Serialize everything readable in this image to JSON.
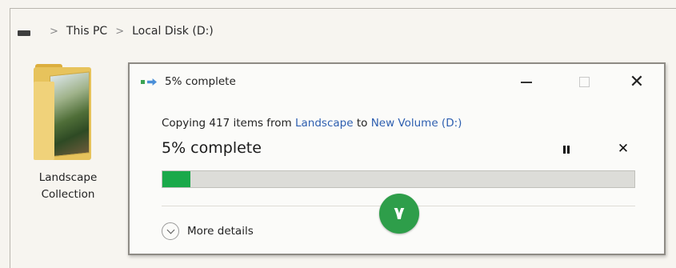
{
  "breadcrumb": {
    "drive_icon": "drive-icon",
    "items": [
      "This PC",
      "Local Disk (D:)"
    ],
    "separator": ">"
  },
  "desktop": {
    "folder_label_line1": "Landscape",
    "folder_label_line2": "Collection"
  },
  "dialog": {
    "title": "5% complete",
    "info_prefix": "Copying 417 items from ",
    "source": "Landscape",
    "info_mid": " to ",
    "destination": "New Volume (D:)",
    "status": "5% complete",
    "progress_fraction": 0.06,
    "more_details": "More details",
    "close_glyph": "✕",
    "cancel_glyph": "✕"
  },
  "badge": {
    "number": "٧",
    "color": "#2e9e4a"
  },
  "colors": {
    "progress": "#1aa94a",
    "link": "#2e5fb0"
  }
}
